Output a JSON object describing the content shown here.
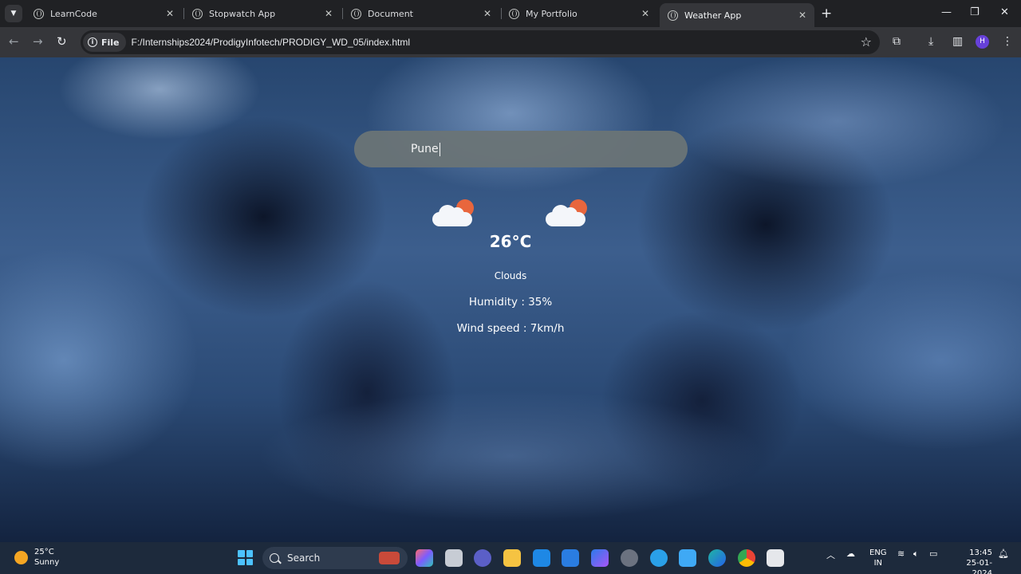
{
  "browser": {
    "tabs": [
      {
        "title": "LearnCode",
        "active": false
      },
      {
        "title": "Stopwatch App",
        "active": false
      },
      {
        "title": "Document",
        "active": false
      },
      {
        "title": "My Portfolio",
        "active": false
      },
      {
        "title": "Weather App",
        "active": true
      }
    ],
    "site_chip": "File",
    "url": "F:/Internships2024/ProdigyInfotech/PRODIGY_WD_05/index.html",
    "profile_initial": "H"
  },
  "weather": {
    "city_input": "Pune",
    "icons": [
      "sun-behind-cloud-icon",
      "sun-behind-cloud-icon"
    ],
    "temperature": "26°C",
    "condition": "Clouds",
    "humidity": "Humidity : 35%",
    "wind": "Wind speed : 7km/h"
  },
  "taskbar": {
    "widget_temp": "25°C",
    "widget_condition": "Sunny",
    "search_label": "Search",
    "lang_line1": "ENG",
    "lang_line2": "IN",
    "time": "13:45",
    "date": "25-01-2024"
  },
  "colors": {
    "accent_sun": "#e8663d",
    "search_bar": "#6a7476",
    "chrome_dark": "#202124"
  }
}
